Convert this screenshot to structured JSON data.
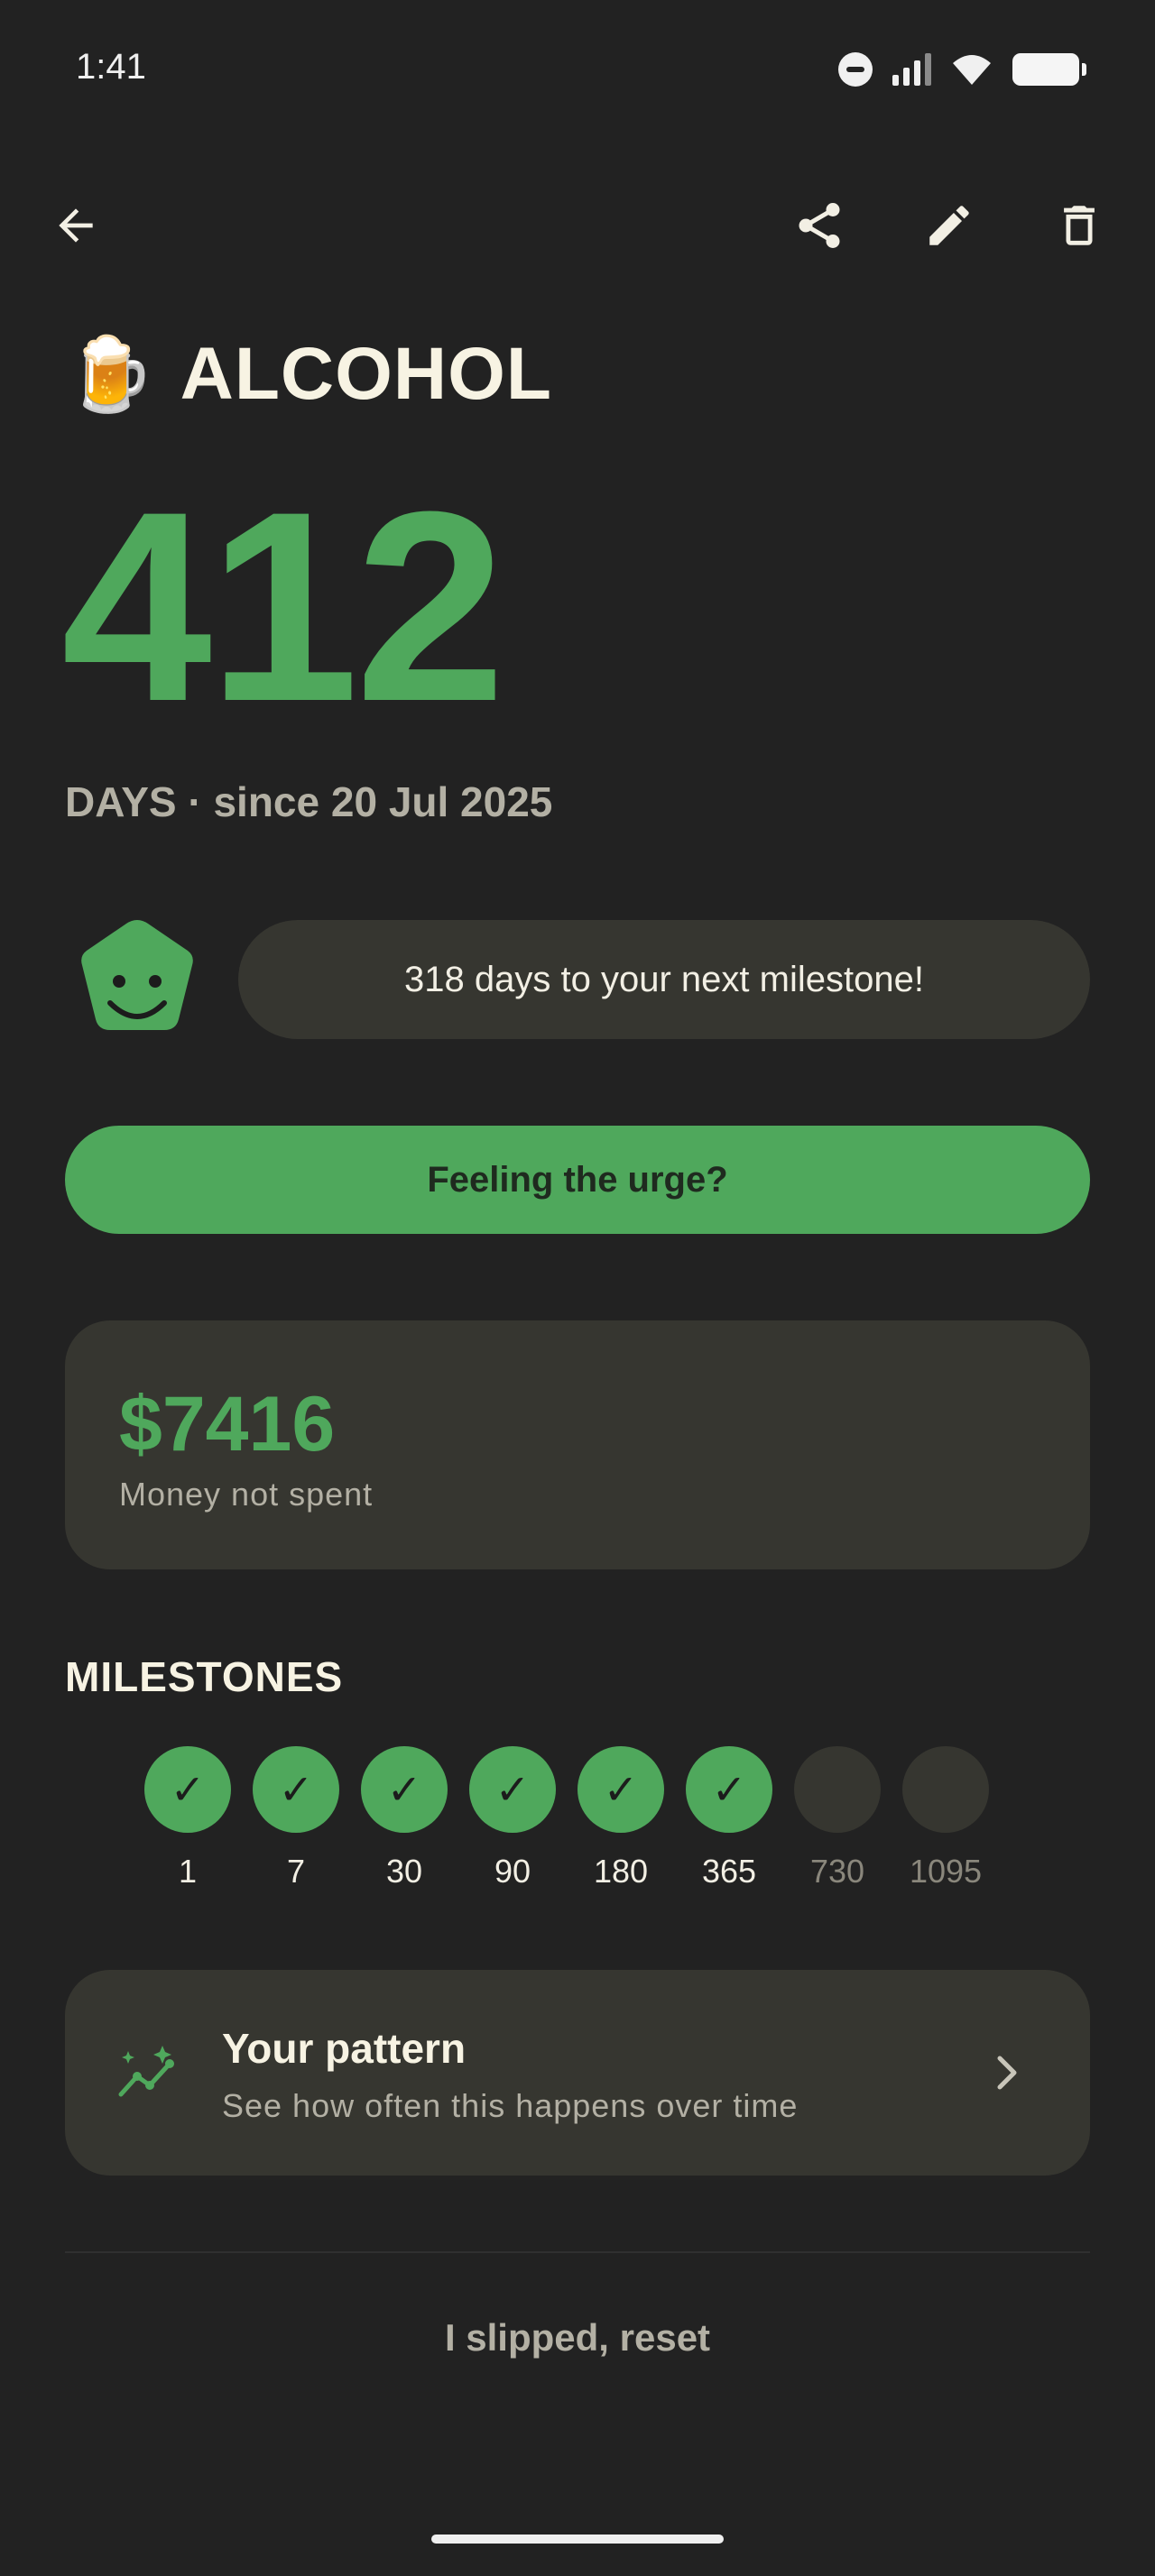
{
  "status_bar": {
    "time": "1:41",
    "icons": [
      "do-not-disturb-icon",
      "signal-icon",
      "wifi-icon",
      "battery-icon"
    ]
  },
  "app_bar": {
    "icons": [
      "back-arrow-icon",
      "share-icon",
      "edit-pencil-icon",
      "delete-trash-icon"
    ]
  },
  "habit": {
    "emoji": "🍺",
    "title": "ALCOHOL",
    "days": "412",
    "since": "DAYS · since 20 Jul 2025"
  },
  "next_milestone": {
    "message": "318 days to your next milestone!"
  },
  "urge_button": {
    "label": "Feeling the urge?"
  },
  "money": {
    "value": "$7416",
    "label": "Money not spent"
  },
  "milestones": {
    "heading": "MILESTONES",
    "check_glyph": "✓",
    "items": [
      {
        "label": "1",
        "achieved": true
      },
      {
        "label": "7",
        "achieved": true
      },
      {
        "label": "30",
        "achieved": true
      },
      {
        "label": "90",
        "achieved": true
      },
      {
        "label": "180",
        "achieved": true
      },
      {
        "label": "365",
        "achieved": true
      },
      {
        "label": "730",
        "achieved": false
      },
      {
        "label": "1095",
        "achieved": false
      }
    ]
  },
  "pattern": {
    "title": "Your pattern",
    "subtitle": "See how often this happens over time"
  },
  "reset": {
    "label": "I slipped, reset"
  },
  "colors": {
    "accent": "#4fa85c",
    "background": "#222222",
    "card": "#363630"
  }
}
